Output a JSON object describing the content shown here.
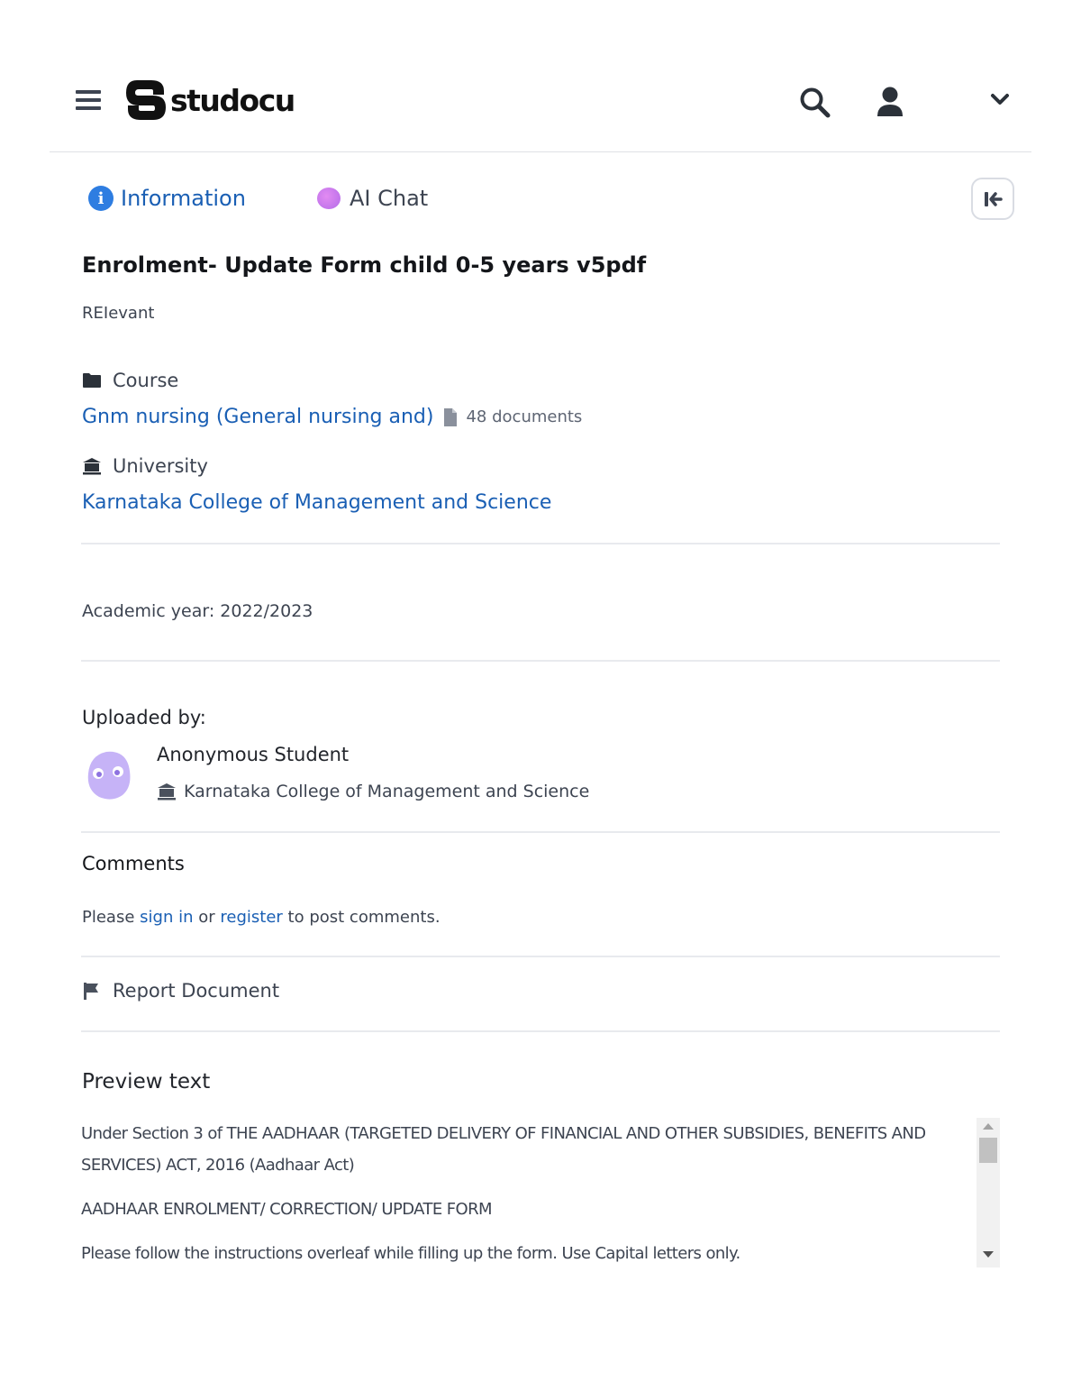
{
  "header": {
    "logo_text": "studocu"
  },
  "tabs": {
    "information": "Information",
    "ai_chat": "AI Chat"
  },
  "document": {
    "title": "Enrolment- Update Form child 0-5 years v5pdf",
    "description": "REIevant"
  },
  "course": {
    "label": "Course",
    "name": "Gnm nursing (General nursing and)",
    "doc_count": "48 documents"
  },
  "university": {
    "label": "University",
    "name": "Karnataka College of Management and Science"
  },
  "academic_year": "Academic year: 2022/2023",
  "uploader": {
    "label": "Uploaded by:",
    "name": "Anonymous Student",
    "university": "Karnataka College of Management and Science"
  },
  "comments": {
    "title": "Comments",
    "prefix": "Please",
    "sign_in": "sign in",
    "or": "or",
    "register": "register",
    "suffix": "to post comments."
  },
  "report": {
    "label": "Report Document"
  },
  "preview": {
    "title": "Preview text",
    "paragraphs": [
      "Under Section 3 of THE AADHAAR (TARGETED DELIVERY OF FINANCIAL AND OTHER SUBSIDIES, BENEFITS AND SERVICES) ACT, 2016 (Aadhaar Act)",
      "AADHAAR ENROLMENT/ CORRECTION/ UPDATE FORM",
      "Please follow the instructions overleaf while filling up the form. Use Capital letters only."
    ]
  },
  "colors": {
    "link": "#1a5fb4",
    "info_icon": "#2e7de1",
    "ai_chat_icon": "#c77ded",
    "avatar": "#c6b3f7"
  }
}
